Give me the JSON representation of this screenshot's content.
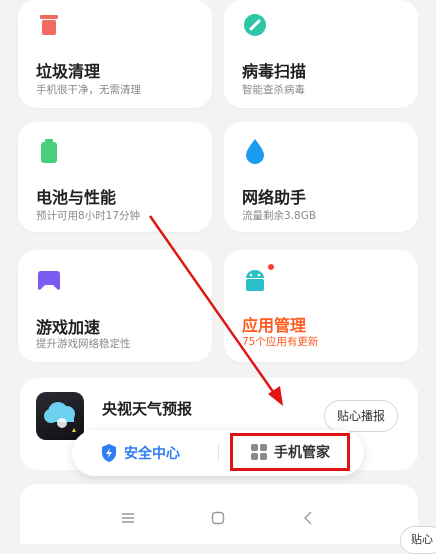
{
  "cards": [
    {
      "title": "垃圾清理",
      "subtitle": "手机很干净，无需清理",
      "icon": "trash-icon",
      "accent": "#f06a5f"
    },
    {
      "title": "病毒扫描",
      "subtitle": "智能查杀病毒",
      "icon": "scan-icon",
      "accent": "#2ec4a6"
    },
    {
      "title": "电池与性能",
      "subtitle": "预计可用8小时17分钟",
      "icon": "battery-icon",
      "accent": "#46d07a"
    },
    {
      "title": "网络助手",
      "subtitle": "流量剩余3.8GB",
      "icon": "water-drop-icon",
      "accent": "#1b9bf0"
    },
    {
      "title": "游戏加速",
      "subtitle": "提升游戏网络稳定性",
      "icon": "gamepad-icon",
      "accent": "#7a5cf0"
    },
    {
      "title": "应用管理",
      "subtitle": "75个应用有更新",
      "icon": "android-icon",
      "accent": "#2bc0c8",
      "badge_color": "#ff3b30"
    }
  ],
  "weather_card": {
    "title": "央视天气预报",
    "button": "贴心播报"
  },
  "switcher": {
    "left_label": "安全中心",
    "right_label": "手机管家"
  },
  "edge_button": "贴心",
  "colors": {
    "highlight": "#e11414",
    "link_blue": "#2e7cf6",
    "update_orange": "#ff5a1f"
  }
}
